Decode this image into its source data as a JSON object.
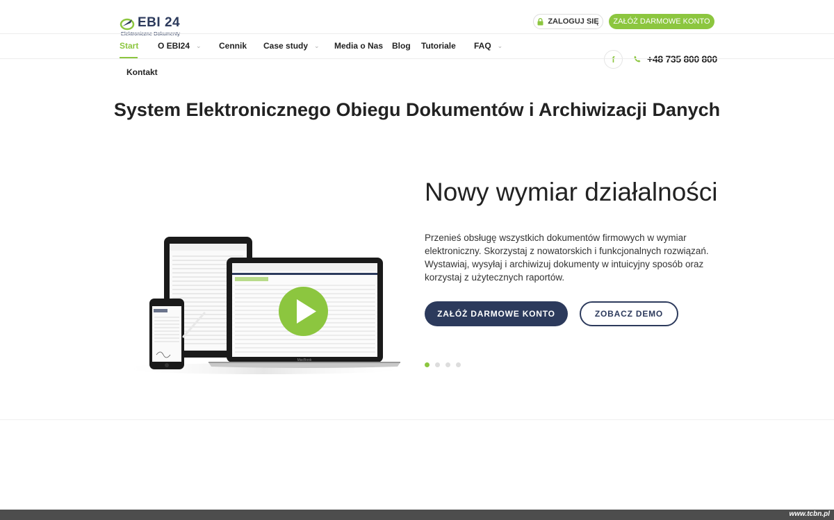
{
  "header": {
    "logo_text": "EBI 24",
    "logo_sub": "Elektroniczne Dokumenty",
    "login_label": "ZALOGUJ SIĘ",
    "register_label": "ZAŁÓŻ DARMOWE KONTO"
  },
  "nav": {
    "items": [
      {
        "label": "Start",
        "active": true
      },
      {
        "label": "O EBI24",
        "dropdown": true
      },
      {
        "label": "Cennik"
      },
      {
        "label": "Case study",
        "dropdown": true
      },
      {
        "label": "Media o Nas"
      },
      {
        "label": "Blog"
      },
      {
        "label": "Tutoriale"
      },
      {
        "label": "FAQ",
        "dropdown": true
      },
      {
        "label": "Kontakt"
      }
    ],
    "facebook_icon": "f",
    "phone": "+48 735 800 800"
  },
  "page_title": "System Elektronicznego Obiegu Dokumentów i Archiwizacji Danych",
  "hero": {
    "heading": "Nowy wymiar działalności",
    "description": "Przenieś obsługę wszystkich dokumentów firmowych w wymiar elektroniczny. Skorzystaj z nowatorskich i funkcjonalnych rozwiązań. Wystawiaj, wysyłaj i archiwizuj dokumenty w intuicyjny sposób oraz korzystaj z użytecznych raportów.",
    "primary_button": "ZAŁÓŻ DARMOWE KONTO",
    "secondary_button": "ZOBACZ DEMO",
    "slides_count": 4,
    "active_slide": 1,
    "laptop_brand": "MacBook"
  },
  "footer": {
    "watermark": "www.tcbn.pl"
  },
  "colors": {
    "accent": "#8cc63f",
    "brand_dark": "#2c3a5c"
  }
}
